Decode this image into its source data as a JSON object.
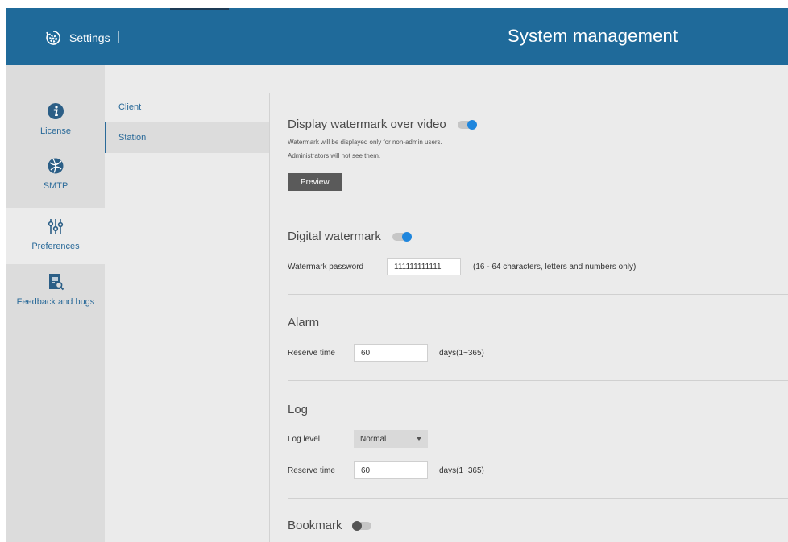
{
  "header": {
    "settings_label": "Settings",
    "title": "System management"
  },
  "sidebar": {
    "items": [
      {
        "label": "License",
        "icon": "info-icon"
      },
      {
        "label": "SMTP",
        "icon": "globe-icon"
      },
      {
        "label": "Preferences",
        "icon": "sliders-icon",
        "active": true
      },
      {
        "label": "Feedback and bugs",
        "icon": "report-icon"
      }
    ]
  },
  "subnav": {
    "items": [
      {
        "label": "Client"
      },
      {
        "label": "Station",
        "active": true
      }
    ]
  },
  "content": {
    "display_watermark": {
      "title": "Display watermark over video",
      "toggle": "on",
      "hint_line1": "Watermark will be displayed only for non-admin users.",
      "hint_line2": "Administrators will not see them.",
      "preview_label": "Preview"
    },
    "digital_watermark": {
      "title": "Digital watermark",
      "toggle": "on",
      "password_label": "Watermark password",
      "password_value": "111111111111",
      "password_note": "(16 - 64 characters, letters and numbers only)"
    },
    "alarm": {
      "title": "Alarm",
      "reserve_label": "Reserve time",
      "reserve_value": "60",
      "reserve_note": "days(1~365)"
    },
    "log": {
      "title": "Log",
      "level_label": "Log level",
      "level_value": "Normal",
      "reserve_label": "Reserve time",
      "reserve_value": "60",
      "reserve_note": "days(1~365)"
    },
    "bookmark": {
      "title": "Bookmark",
      "toggle": "off"
    }
  },
  "colors": {
    "header": "#1f6a9a",
    "accent": "#2a6a99",
    "toggle_on": "#1f86dd"
  }
}
